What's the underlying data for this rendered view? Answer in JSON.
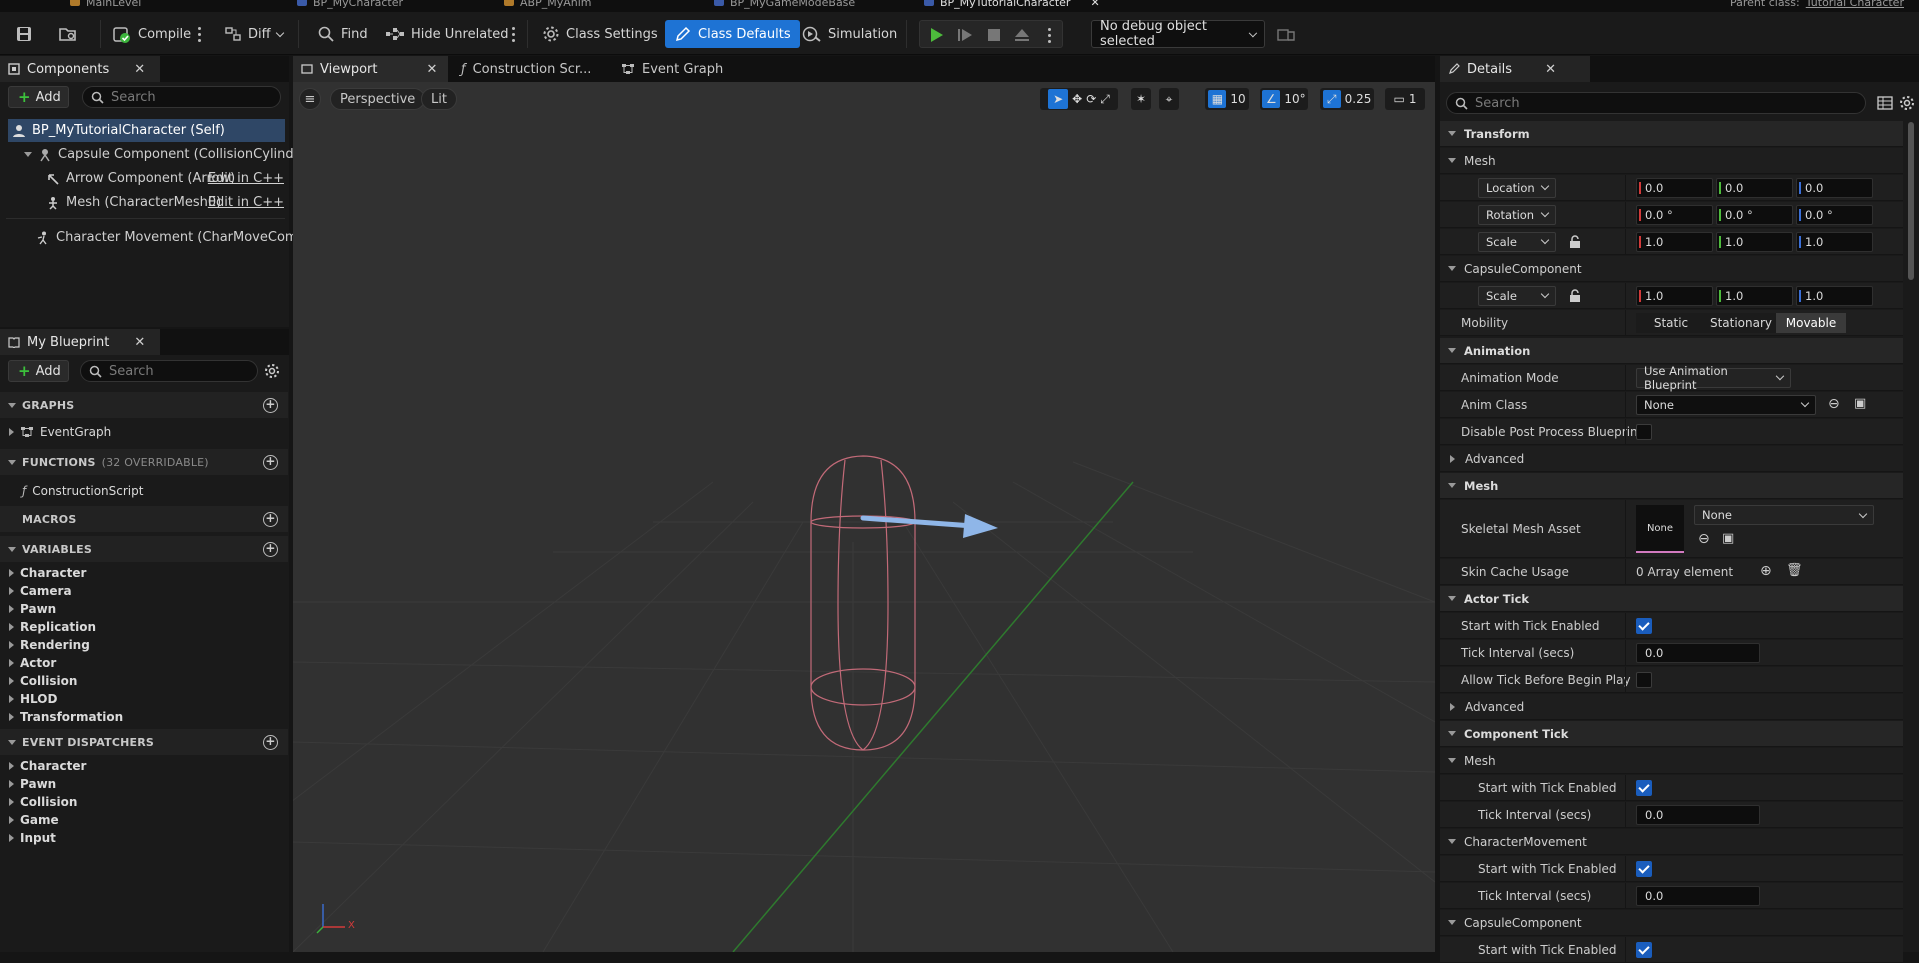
{
  "doc_tabs": [
    "MainLevel",
    "BP_MyCharacter",
    "ABP_MyAnim",
    "BP_MyGameModeBase",
    "BP_MyTutorialCharacter"
  ],
  "parent_class": {
    "label": "Parent class:",
    "value": "Tutorial Character"
  },
  "toolbar": {
    "compile": "Compile",
    "diff": "Diff",
    "find": "Find",
    "hide_unrelated": "Hide Unrelated",
    "class_settings": "Class Settings",
    "class_defaults": "Class Defaults",
    "simulation": "Simulation",
    "debug_object": "No debug object selected"
  },
  "components_panel": {
    "tab": "Components",
    "add": "Add",
    "search_placeholder": "Search",
    "items": [
      {
        "label": "BP_MyTutorialCharacter (Self)"
      },
      {
        "label": "Capsule Component (CollisionCylinder)"
      },
      {
        "label": "Arrow Component (Arrow)",
        "action": "Edit in C++"
      },
      {
        "label": "Mesh (CharacterMesh0)",
        "action": "Edit in C++"
      },
      {
        "label": "Character Movement (CharMoveComp)"
      }
    ]
  },
  "my_blueprint": {
    "tab": "My Blueprint",
    "add": "Add",
    "search_placeholder": "Search",
    "graphs_header": "GRAPHS",
    "graphs": [
      "EventGraph"
    ],
    "functions_header": "FUNCTIONS",
    "functions_sub": "(32 OVERRIDABLE)",
    "functions": [
      "ConstructionScript"
    ],
    "macros_header": "MACROS",
    "variables_header": "VARIABLES",
    "variables": [
      "Character",
      "Camera",
      "Pawn",
      "Replication",
      "Rendering",
      "Actor",
      "Collision",
      "HLOD",
      "Transformation"
    ],
    "dispatchers_header": "EVENT DISPATCHERS",
    "dispatchers": [
      "Character",
      "Pawn",
      "Collision",
      "Game",
      "Input"
    ]
  },
  "editor_tabs": {
    "viewport": "Viewport",
    "construction": "Construction Scr...",
    "event_graph": "Event Graph"
  },
  "viewport": {
    "perspective": "Perspective",
    "lit": "Lit",
    "grid_snap": "10",
    "rot_snap": "10°",
    "scale_snap": "0.25",
    "camera_speed": "1",
    "axis_x": "X",
    "colors": {
      "capsule": "#c26a78",
      "arrow": "#8fb6e8",
      "green_axis": "#2e7a2e"
    }
  },
  "details": {
    "tab": "Details",
    "search_placeholder": "Search",
    "transform": "Transform",
    "mesh_sub": "Mesh",
    "location_label": "Location",
    "location": [
      "0.0",
      "0.0",
      "0.0"
    ],
    "rotation_label": "Rotation",
    "rotation": [
      "0.0 °",
      "0.0 °",
      "0.0 °"
    ],
    "scale_label": "Scale",
    "scale": [
      "1.0",
      "1.0",
      "1.0"
    ],
    "capsule_sub": "CapsuleComponent",
    "capsule_scale_label": "Scale",
    "capsule_scale": [
      "1.0",
      "1.0",
      "1.0"
    ],
    "mobility_label": "Mobility",
    "mobility_options": [
      "Static",
      "Stationary",
      "Movable"
    ],
    "mobility_selected": "Movable",
    "animation": "Animation",
    "animation_mode_label": "Animation Mode",
    "animation_mode": "Use Animation Blueprint",
    "anim_class_label": "Anim Class",
    "anim_class": "None",
    "disable_pp_label": "Disable Post Process Blueprint",
    "disable_pp": false,
    "advanced": "Advanced",
    "mesh_cat": "Mesh",
    "skeletal_mesh_label": "Skeletal Mesh Asset",
    "skeletal_mesh_thumb": "None",
    "skeletal_mesh": "None",
    "skin_cache_label": "Skin Cache Usage",
    "skin_cache": "0 Array element",
    "actor_tick": "Actor Tick",
    "start_tick_label": "Start with Tick Enabled",
    "start_tick": true,
    "tick_interval_label": "Tick Interval (secs)",
    "tick_interval": "0.0",
    "allow_tick_label": "Allow Tick Before Begin Play",
    "allow_tick": false,
    "advanced2": "Advanced",
    "component_tick": "Component Tick",
    "ct_mesh": "Mesh",
    "ct_mesh_start_label": "Start with Tick Enabled",
    "ct_mesh_interval_label": "Tick Interval (secs)",
    "ct_mesh_interval": "0.0",
    "ct_charmove": "CharacterMovement",
    "ct_cm_start_label": "Start with Tick Enabled",
    "ct_cm_interval_label": "Tick Interval (secs)",
    "ct_cm_interval": "0.0",
    "ct_capsule": "CapsuleComponent",
    "ct_cap_start_label": "Start with Tick Enabled"
  }
}
